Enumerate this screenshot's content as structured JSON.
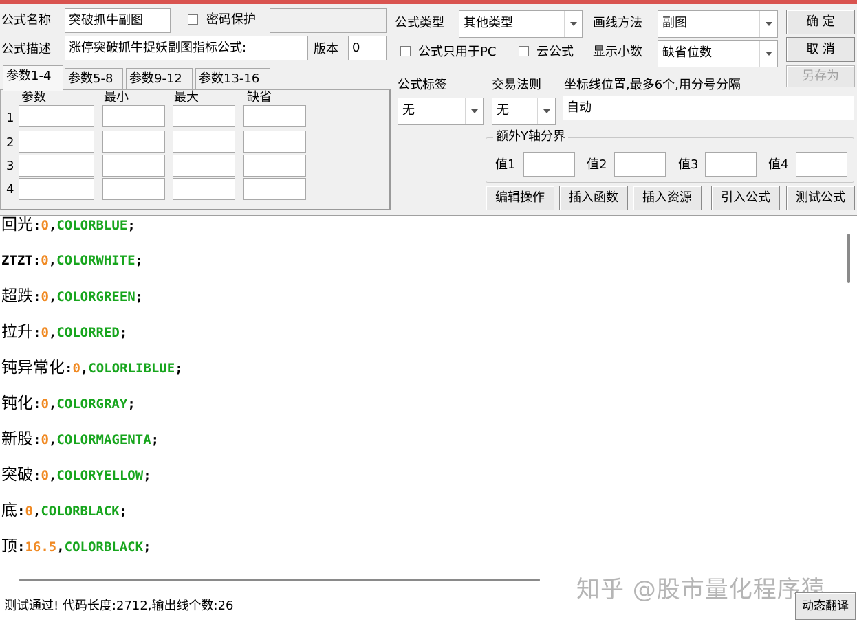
{
  "form": {
    "name_label": "公式名称",
    "name_value": "突破抓牛副图",
    "password_label": "密码保护",
    "desc_label": "公式描述",
    "desc_value": "涨停突破抓牛捉妖副图指标公式:",
    "version_label": "版本",
    "version_value": "0",
    "type_label": "公式类型",
    "type_value": "其他类型",
    "draw_label": "画线方法",
    "draw_value": "副图",
    "pc_only_label": "公式只用于PC",
    "cloud_label": "云公式",
    "decimals_label": "显示小数",
    "decimals_value": "缺省位数",
    "tag_label": "公式标签",
    "tag_value": "无",
    "trade_label": "交易法则",
    "trade_value": "无",
    "axis_label": "坐标线位置,最多6个,用分号分隔",
    "axis_value": "自动"
  },
  "buttons": {
    "ok": "确  定",
    "cancel": "取  消",
    "save_as": "另存为",
    "edit": "编辑操作",
    "insert_func": "插入函数",
    "insert_res": "插入资源",
    "import": "引入公式",
    "test": "测试公式",
    "translate": "动态翻译"
  },
  "tabs": [
    "参数1-4",
    "参数5-8",
    "参数9-12",
    "参数13-16"
  ],
  "params": {
    "headers": [
      "参数",
      "最小",
      "最大",
      "缺省"
    ],
    "rows": [
      "1",
      "2",
      "3",
      "4"
    ]
  },
  "yaxis": {
    "title": "额外Y轴分界",
    "labels": [
      "值1",
      "值2",
      "值3",
      "值4"
    ]
  },
  "code": [
    {
      "name": "回光",
      "sep": ":",
      "num": "0",
      "comma": ",",
      "color": "COLORBLUE",
      "end": ";"
    },
    {
      "name": "ZTZT",
      "sep": ":",
      "num": "0",
      "comma": ",",
      "color": "COLORWHITE",
      "end": ";"
    },
    {
      "name": "超跌",
      "sep": ":",
      "num": "0",
      "comma": ",",
      "color": "COLORGREEN",
      "end": ";"
    },
    {
      "name": "拉升",
      "sep": ":",
      "num": "0",
      "comma": ",",
      "color": "COLORRED",
      "end": ";"
    },
    {
      "name": "钝异常化",
      "sep": ":",
      "num": "0",
      "comma": ",",
      "color": "COLORLIBLUE",
      "end": ";"
    },
    {
      "name": "钝化",
      "sep": ":",
      "num": "0",
      "comma": ",",
      "color": "COLORGRAY",
      "end": ";"
    },
    {
      "name": "新股",
      "sep": ":",
      "num": "0",
      "comma": ",",
      "color": "COLORMAGENTA",
      "end": ";"
    },
    {
      "name": "突破",
      "sep": ":",
      "num": "0",
      "comma": ",",
      "color": "COLORYELLOW",
      "end": ";"
    },
    {
      "name": "底",
      "sep": ":",
      "num": "0",
      "comma": ",",
      "color": "COLORBLACK",
      "end": ";"
    },
    {
      "name": "顶",
      "sep": ":",
      "num": "16.5",
      "comma": ",",
      "color": "COLORBLACK",
      "end": ";"
    }
  ],
  "status": "测试通过! 代码长度:2712,输出线个数:26",
  "watermark": "知乎 @股市量化程序猿",
  "colors": {
    "title_bar": "#d9534f",
    "number": "#f08a24",
    "keyword": "#17a51d"
  }
}
